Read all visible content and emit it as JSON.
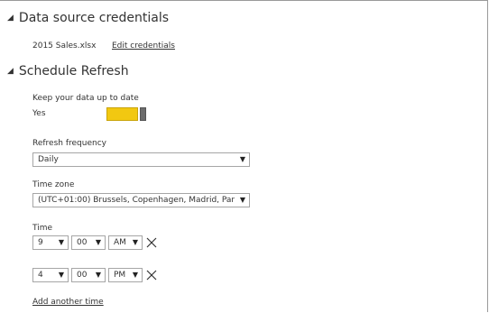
{
  "credentials": {
    "header": "Data source credentials",
    "file_name": "2015 Sales.xlsx",
    "edit_link": "Edit credentials"
  },
  "schedule": {
    "header": "Schedule Refresh",
    "keep_up_to_date_label": "Keep your data up to date",
    "toggle_value_label": "Yes",
    "toggle_on": true,
    "toggle_color": "#f2c811",
    "refresh_frequency_label": "Refresh frequency",
    "refresh_frequency_value": "Daily",
    "time_zone_label": "Time zone",
    "time_zone_value": "(UTC+01:00) Brussels, Copenhagen, Madrid, Par",
    "time_label": "Time",
    "times": [
      {
        "hour": "9",
        "minute": "00",
        "ampm": "AM"
      },
      {
        "hour": "4",
        "minute": "00",
        "ampm": "PM"
      }
    ],
    "add_time_link": "Add another time"
  },
  "icons": {
    "collapse_caret": "caret-down-icon",
    "dropdown_arrow": "chevron-down-icon",
    "remove_time": "close-icon"
  }
}
